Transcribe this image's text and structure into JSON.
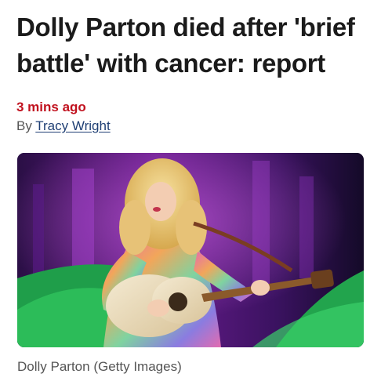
{
  "article": {
    "headline": "Dolly Parton died after 'brief battle' with cancer: report",
    "timestamp": "3 mins ago",
    "byline_prefix": "By",
    "author": "Tracy Wright"
  },
  "image": {
    "description_icon": "photo-of-performer-with-guitar",
    "caption": "Dolly Parton (Getty Images)"
  },
  "colors": {
    "timestamp": "#c1121f",
    "author_link": "#1f3f74",
    "headline": "#1b1b1b"
  }
}
